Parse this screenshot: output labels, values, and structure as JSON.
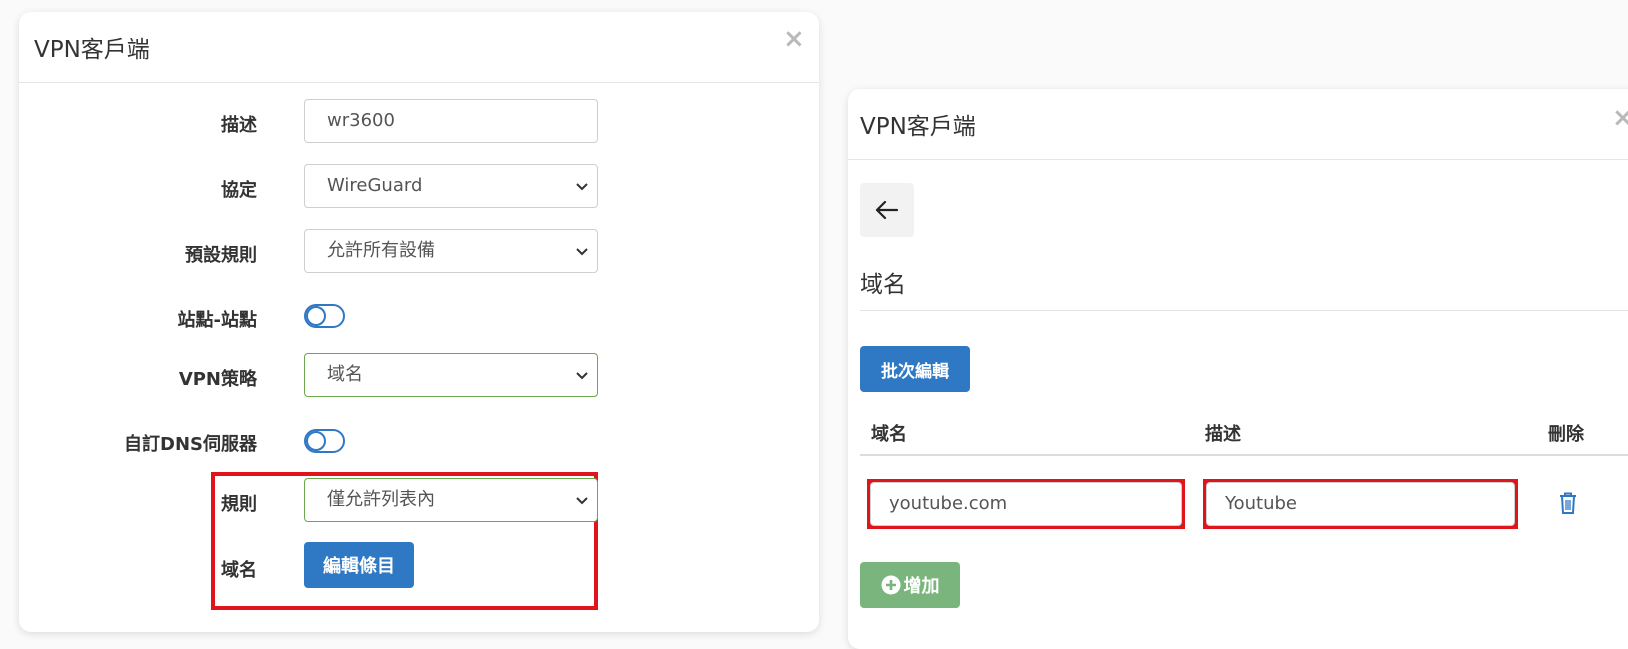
{
  "left_modal": {
    "title": "VPN客戶端",
    "close": "×",
    "fields": {
      "description": {
        "label": "描述",
        "value": "wr3600"
      },
      "protocol": {
        "label": "協定",
        "value": "WireGuard"
      },
      "default_rule": {
        "label": "預設規則",
        "value": "允許所有設備"
      },
      "site_to_site": {
        "label": "站點-站點",
        "state": "off"
      },
      "vpn_policy": {
        "label": "VPN策略",
        "value": "域名"
      },
      "custom_dns": {
        "label": "自訂DNS伺服器",
        "state": "off"
      },
      "rule": {
        "label": "規則",
        "value": "僅允許列表內"
      },
      "domain": {
        "label": "域名",
        "button": "編輯條目"
      }
    }
  },
  "right_modal": {
    "title": "VPN客戶端",
    "close": "×",
    "back_icon": "arrow-left-icon",
    "section_title": "域名",
    "batch_edit_label": "批次編輯",
    "table": {
      "headers": {
        "domain": "域名",
        "description": "描述",
        "delete": "刪除"
      },
      "rows": [
        {
          "domain": "youtube.com",
          "description": "Youtube"
        }
      ]
    },
    "add_label": "增加"
  },
  "colors": {
    "primary": "#2f78c4",
    "success": "#7ab57d",
    "highlight": "#e0141b",
    "valid_border": "#6aa84f"
  }
}
